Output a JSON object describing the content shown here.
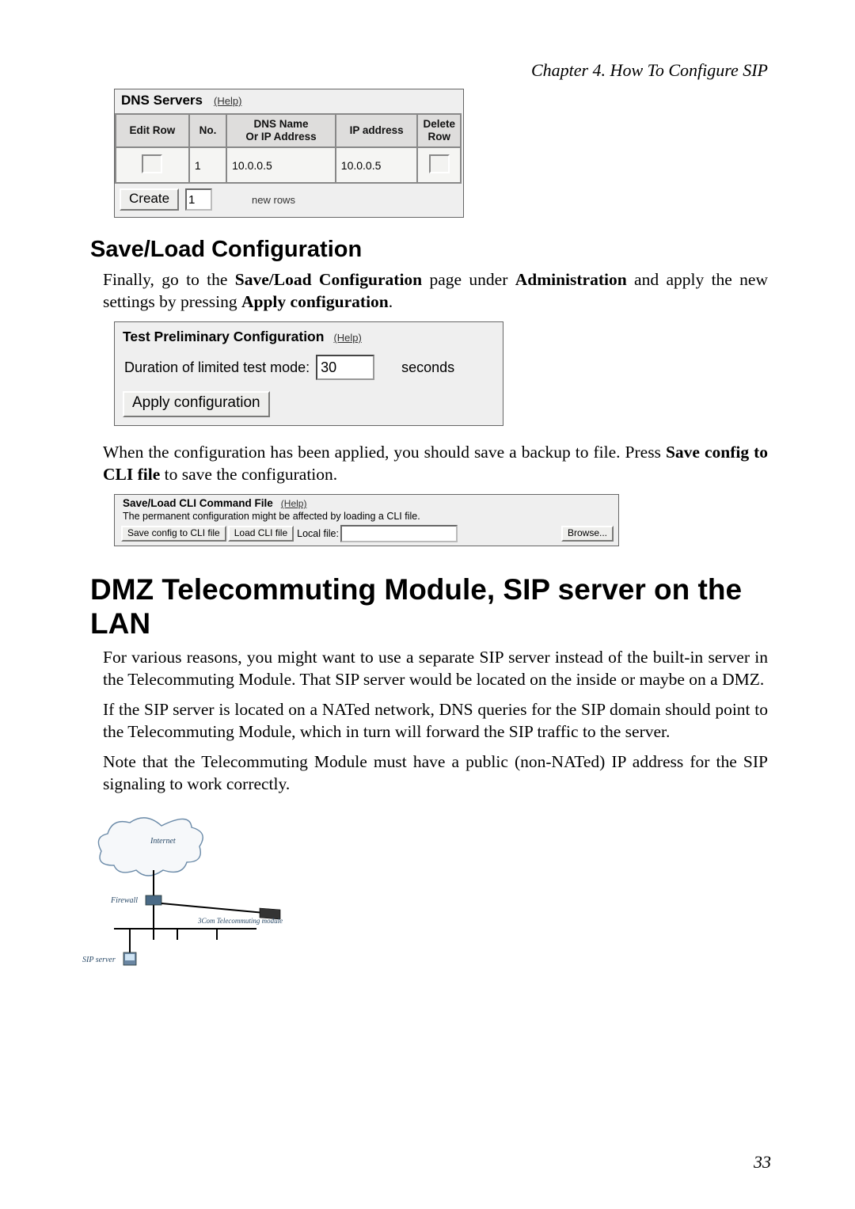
{
  "chapter_header": "Chapter 4. How To Configure SIP",
  "dns_panel": {
    "title": "DNS Servers",
    "help": "(Help)",
    "headers": {
      "edit_row": "Edit Row",
      "no": "No.",
      "dns_name": "DNS Name\nOr IP Address",
      "ip": "IP address",
      "delete": "Delete Row"
    },
    "rows": [
      {
        "no": "1",
        "dns_name": "10.0.0.5",
        "ip": "10.0.0.5"
      }
    ],
    "create_label": "Create",
    "create_value": "1",
    "new_rows": "new rows"
  },
  "section_saveload": "Save/Load Configuration",
  "para1_a": "Finally, go to the ",
  "para1_b": "Save/Load Configuration",
  "para1_c": " page under ",
  "para1_d": "Administration",
  "para1_e": " and apply the new settings by pressing ",
  "para1_f": "Apply configuration",
  "para1_g": ".",
  "test_panel": {
    "title": "Test Preliminary Configuration",
    "help": "(Help)",
    "duration_label": "Duration of limited test mode:",
    "duration_value": "30",
    "seconds": "seconds",
    "apply": "Apply configuration"
  },
  "para2_a": "When the configuration has been applied, you should save a backup to file. Press ",
  "para2_b": "Save config to CLI file",
  "para2_c": " to save the configuration.",
  "cli_panel": {
    "title": "Save/Load CLI Command File",
    "help": "(Help)",
    "note": "The permanent configuration might be affected by loading a CLI file.",
    "save_btn": "Save config to CLI file",
    "load_btn": "Load CLI file",
    "local_file": "Local file:",
    "browse": "Browse..."
  },
  "big_section": "DMZ Telecommuting Module, SIP server on the LAN",
  "para3": "For various reasons, you might want to use a separate SIP server instead of the built-in server in the Telecommuting Module. That SIP server would be located on the inside or maybe on a DMZ.",
  "para4": "If the SIP server is located on a NATed network, DNS queries for the SIP domain should point to the Telecommuting Module, which in turn will forward the SIP traffic to the server.",
  "para5": "Note that the Telecommuting Module must have a public (non-NATed) IP address for the SIP signaling to work correctly.",
  "diagram": {
    "internet": "Internet",
    "firewall": "Firewall",
    "module": "3Com Telecommuting module",
    "sip": "SIP server"
  },
  "page_number": "33"
}
